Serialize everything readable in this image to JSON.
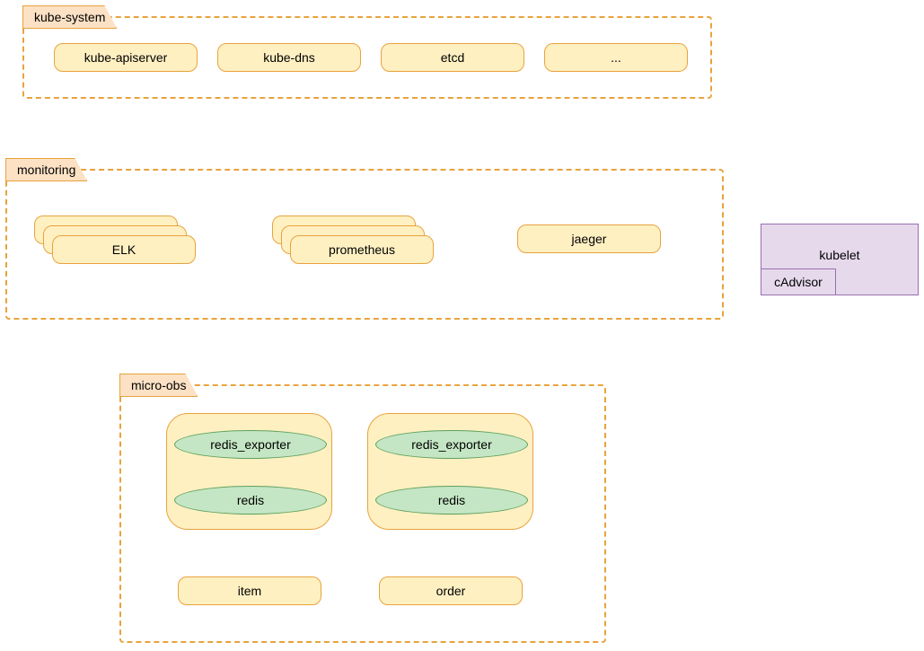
{
  "namespaces": {
    "kube_system": {
      "label": "kube-system",
      "items": [
        "kube-apiserver",
        "kube-dns",
        "etcd",
        "..."
      ]
    },
    "monitoring": {
      "label": "monitoring",
      "stacks": [
        "ELK",
        "prometheus"
      ],
      "single": "jaeger"
    },
    "micro_obs": {
      "label": "micro-obs",
      "pod1": {
        "top": "redis_exporter",
        "bottom": "redis"
      },
      "pod2": {
        "top": "redis_exporter",
        "bottom": "redis"
      },
      "services": [
        "item",
        "order"
      ]
    }
  },
  "kubelet": {
    "label": "kubelet",
    "cadvisor": "cAdvisor"
  }
}
